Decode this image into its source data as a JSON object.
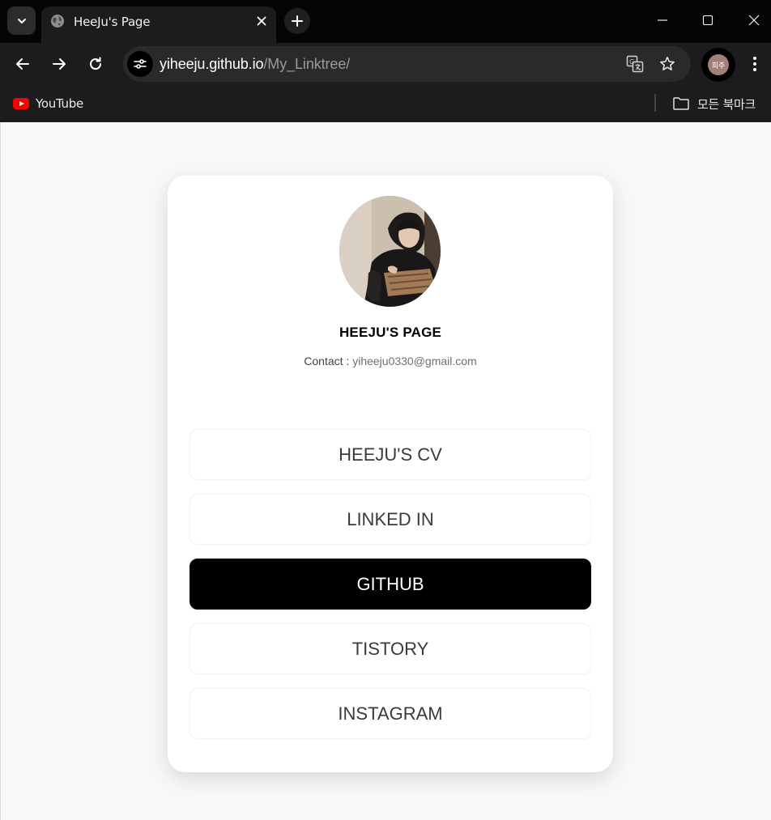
{
  "browser": {
    "tab": {
      "title": "HeeJu's Page"
    },
    "address_bar": {
      "host": "yiheeju.github.io",
      "path": "/My_Linktree/"
    },
    "profile": {
      "label": "희주"
    },
    "bookmarks": [
      {
        "label": "YouTube",
        "icon": "youtube-icon"
      }
    ],
    "all_bookmarks_label": "모든 북마크",
    "icons": [
      "tab-list-icon",
      "globe-icon",
      "close-icon",
      "plus-icon",
      "minimize-icon",
      "maximize-icon",
      "window-close-icon",
      "back-arrow-icon",
      "forward-arrow-icon",
      "reload-icon",
      "site-info-icon",
      "translate-icon",
      "star-icon",
      "more-vert-icon",
      "folder-icon"
    ]
  },
  "page": {
    "profile_name": "HEEJU'S PAGE",
    "contact_label": "Contact : ",
    "contact_email": "yiheeju0330@gmail.com",
    "links": [
      {
        "label": "HEEJU'S CV",
        "active": false
      },
      {
        "label": "LINKED IN",
        "active": false
      },
      {
        "label": "GITHUB",
        "active": true
      },
      {
        "label": "TISTORY",
        "active": false
      },
      {
        "label": "INSTAGRAM",
        "active": false
      }
    ]
  },
  "colors": {
    "page_bg": "#f8f8f8",
    "card_bg": "#ffffff",
    "active_button_bg": "#000000",
    "active_button_text": "#ffffff",
    "button_text": "#3a3a3a",
    "chrome_bg": "#1c1c1e"
  }
}
